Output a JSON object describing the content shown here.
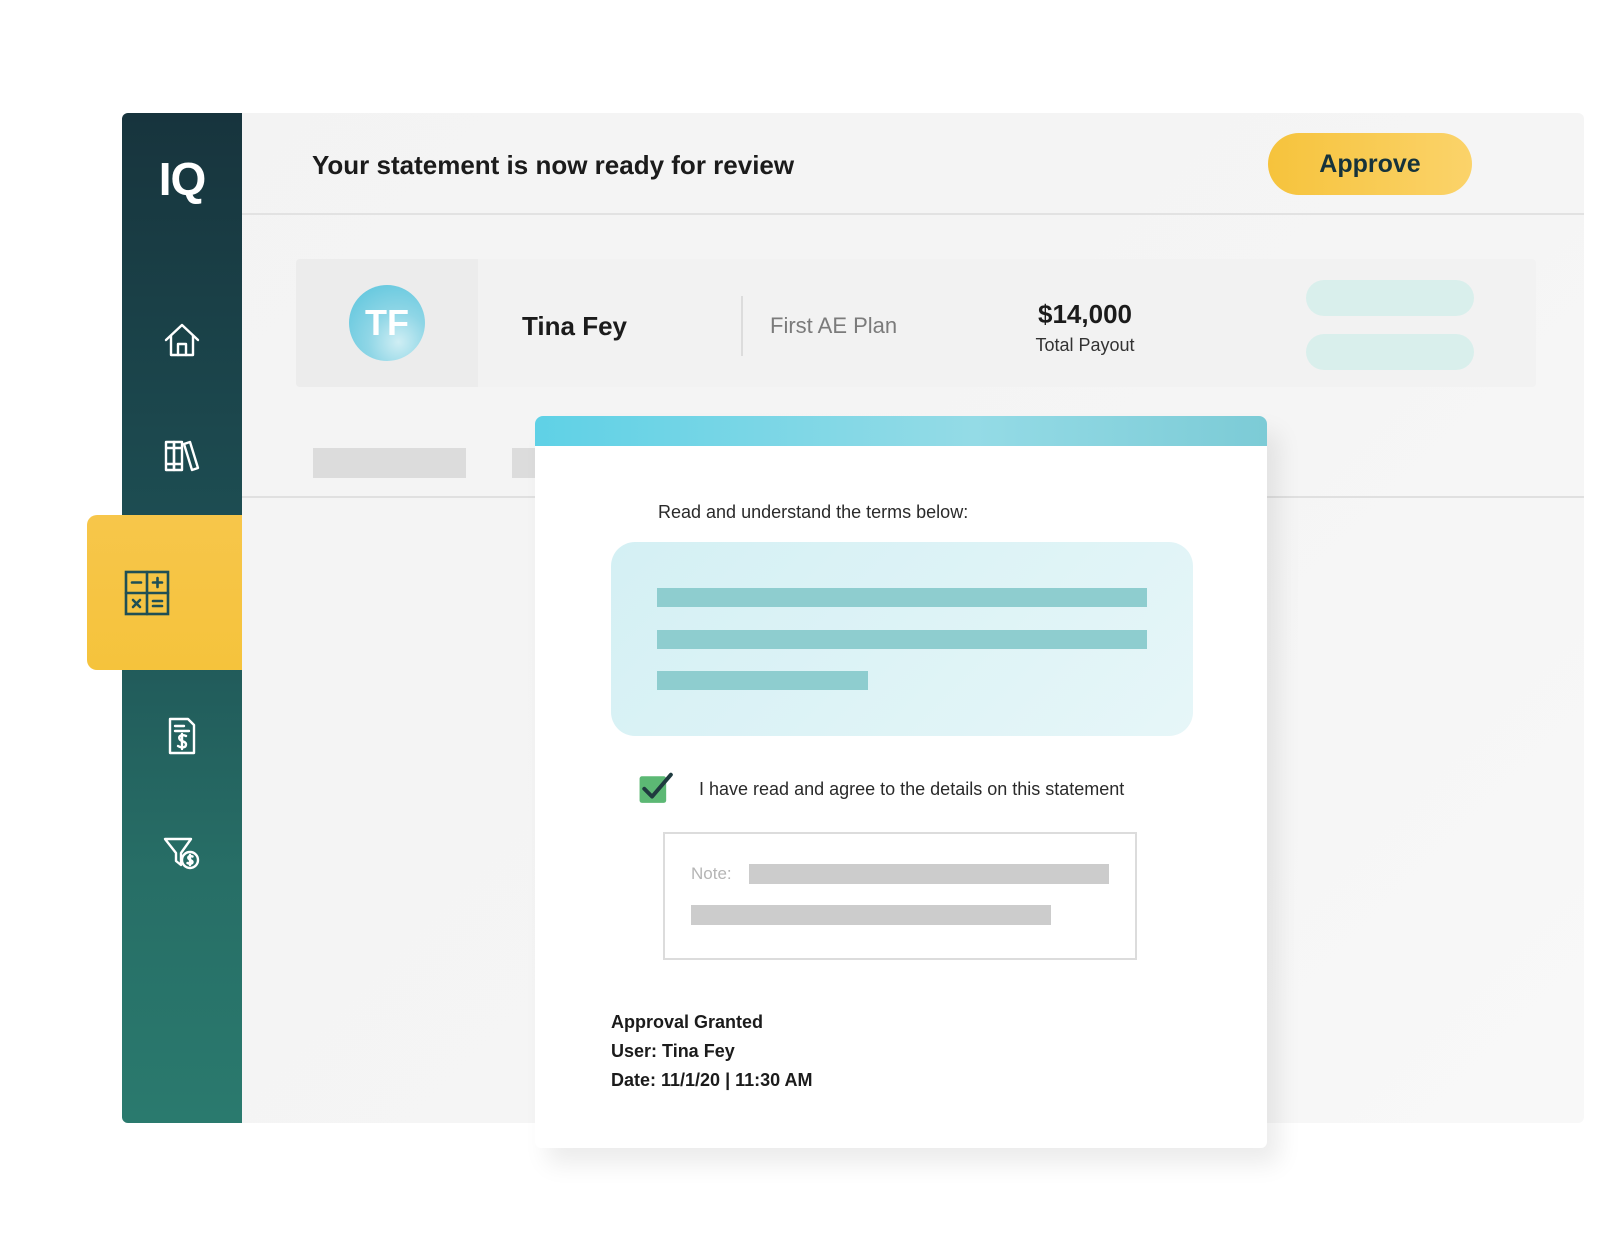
{
  "sidebar": {
    "logo": "IQ",
    "items": [
      {
        "icon": "home-icon"
      },
      {
        "icon": "library-icon"
      },
      {
        "icon": "calculator-icon",
        "active": true
      },
      {
        "icon": "invoice-dollar-icon"
      },
      {
        "icon": "filter-dollar-icon"
      }
    ]
  },
  "header": {
    "title": "Your statement is now ready for review",
    "approve_label": "Approve"
  },
  "profile": {
    "initials": "TF",
    "name": "Tina Fey",
    "plan": "First AE Plan",
    "payout_amount": "$14,000",
    "payout_label": "Total Payout"
  },
  "modal": {
    "instruction": "Read and understand the terms below:",
    "agree_label": "I have read and agree to the details on this statement",
    "agree_checked": true,
    "note_label": "Note:",
    "approval": {
      "status": "Approval Granted",
      "user": "User: Tina Fey",
      "date": "Date: 11/1/20 | 11:30 AM"
    }
  },
  "colors": {
    "sidebar_top": "#17343d",
    "sidebar_bottom": "#2a7a6e",
    "accent_yellow": "#f6c33c",
    "modal_bar": "#5fd1e6",
    "check_green": "#5cb874"
  }
}
